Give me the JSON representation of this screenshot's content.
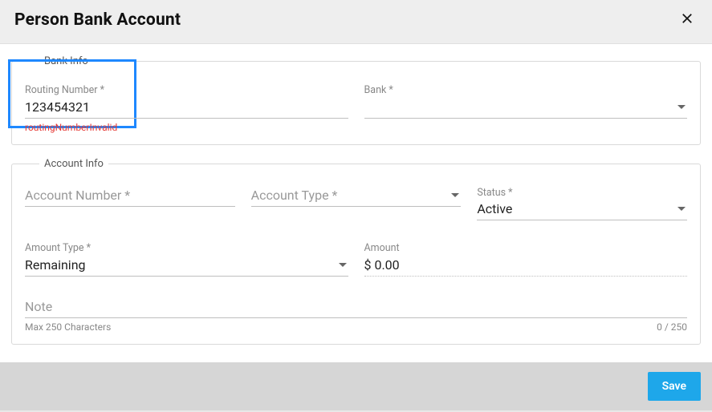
{
  "header": {
    "title": "Person Bank Account"
  },
  "bankInfo": {
    "legend": "Bank Info",
    "routing": {
      "label": "Routing Number *",
      "value": "123454321",
      "error": "routingNumberInvalid"
    },
    "bank": {
      "label": "Bank *",
      "value": ""
    }
  },
  "accountInfo": {
    "legend": "Account Info",
    "accountNumber": {
      "label": "Account Number *",
      "value": ""
    },
    "accountType": {
      "label": "Account Type *",
      "value": ""
    },
    "status": {
      "label": "Status *",
      "value": "Active"
    },
    "amountType": {
      "label": "Amount Type *",
      "value": "Remaining"
    },
    "amount": {
      "label": "Amount",
      "value": "$ 0.00"
    },
    "note": {
      "label": "Note",
      "hint": "Max 250 Characters",
      "counter": "0 / 250"
    }
  },
  "footer": {
    "save": "Save"
  }
}
